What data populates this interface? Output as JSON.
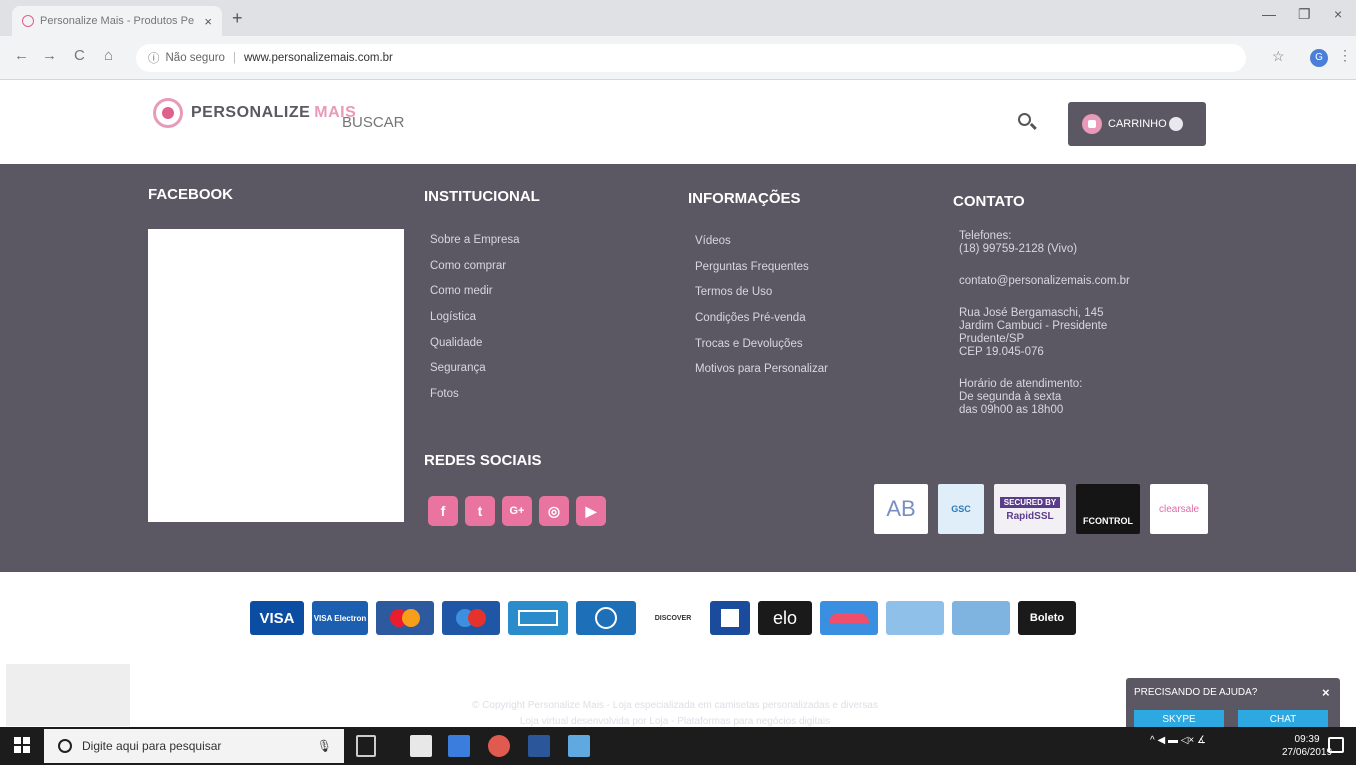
{
  "browser": {
    "tab_title": "Personalize Mais - Produtos Pe",
    "tab_close": "×",
    "new_tab": "+",
    "security_label": "Não seguro",
    "separator": "|",
    "url": "www.personalizemais.com.br",
    "profile_initial": "G",
    "back": "←",
    "forward": "→",
    "reload": "C",
    "home": "⌂",
    "info": "ⓘ",
    "star": "☆",
    "menu": "⋮",
    "minimize": "—",
    "maximize": "❐",
    "close": "×"
  },
  "header": {
    "logo_text_1": "PERSONALIZE",
    "logo_text_2": "MAIS",
    "search_placeholder": "BUSCAR",
    "cart_label": "CARRINHO"
  },
  "footer": {
    "facebook_title": "FACEBOOK",
    "institucional": {
      "title": "INSTITUCIONAL",
      "links": [
        "Sobre a Empresa",
        "Como comprar",
        "Como medir",
        "Logística",
        "Qualidade",
        "Segurança",
        "Fotos"
      ]
    },
    "informacoes": {
      "title": "INFORMAÇÕES",
      "links": [
        "Vídeos",
        "Perguntas Frequentes",
        "Termos de Uso",
        "Condições Pré-venda",
        "Trocas e Devoluções",
        "Motivos para Personalizar"
      ]
    },
    "contato": {
      "title": "CONTATO",
      "phones_label": "Telefones:",
      "phone": "(18) 99759-2128 (Vivo)",
      "email": "contato@personalizemais.com.br",
      "address_1": "Rua José Bergamaschi, 145",
      "address_2": "Jardim Cambuci - Presidente",
      "address_3": "Prudente/SP",
      "address_4": "CEP 19.045-076",
      "hours_label": "Horário de atendimento:",
      "hours_1": "De segunda à sexta",
      "hours_2": "das 09h00 as 18h00"
    },
    "redes_title": "REDES SOCIAIS",
    "social_icons": [
      "f",
      "t",
      "G+",
      "◎",
      "▶"
    ],
    "seals": {
      "ab": "AB",
      "gsc": "GSC",
      "rapidssl_top": "SECURED BY",
      "rapidssl": "RapidSSL",
      "fcontrol": "FCONTROL",
      "clearsale": "clearsale"
    }
  },
  "payments": {
    "visa": "VISA",
    "visa_electron": "VISA Electron",
    "discover": "DISCOVER",
    "elo": "elo",
    "boleto": "Boleto"
  },
  "copyright": {
    "line1": "© Copyright Personalize Mais - Loja especializada em camisetas personalizadas e diversas",
    "line2": "Loja virtual desenvolvida por Loja - Plataformas para negócios digitais"
  },
  "help": {
    "title": "PRECISANDO DE AJUDA?",
    "close": "×",
    "skype": "SKYPE",
    "chat": "CHAT"
  },
  "taskbar": {
    "search_text": "Digite aqui para pesquisar",
    "mic": "🎙",
    "tray": "^ ◀ ▬ ◁× ∡",
    "time": "09:39",
    "date": "27/06/2019"
  }
}
